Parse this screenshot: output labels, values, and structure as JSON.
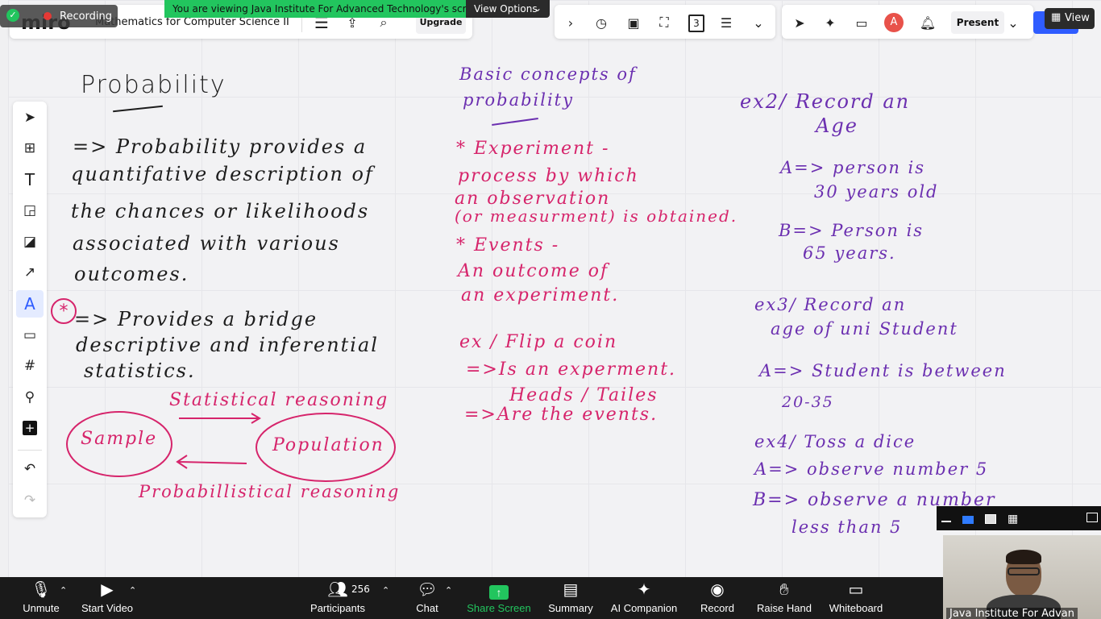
{
  "recording": {
    "label": "Recording"
  },
  "app": {
    "logo": "miro"
  },
  "share_banner": {
    "text": "You are viewing Java Institute For Advanced Technology's screen",
    "view_options": "View Options"
  },
  "board_title": "Mathematics for Computer Science II",
  "upgrade": "Upgrade",
  "toolbar_right": {
    "page_number": "3",
    "avatar_initial": "A",
    "present": "Present",
    "view": "View"
  },
  "notes": {
    "probability_title": "Probability",
    "def_lines": [
      "=> Probability provides a",
      "quantifative description of",
      "the chances or likelihoods",
      "associated with various",
      "outcomes."
    ],
    "bridge_lines": [
      "=> Provides a bridge",
      "descriptive and inferential",
      "statistics."
    ],
    "star_mark": "*",
    "statistical_reasoning": "Statistical reasoning",
    "sample": "Sample",
    "population": "Population",
    "probabilistic_reasoning": "Probabillistical reasoning",
    "basic_concepts_lines": [
      "Basic concepts of",
      "probability"
    ],
    "experiment_lines": [
      "* Experiment -",
      "process by which",
      "an observation",
      "(or measurment) is obtained."
    ],
    "events_lines": [
      "* Events -",
      "An outcome of",
      "an experiment."
    ],
    "ex1_lines": [
      "ex / Flip a coin",
      "=>Is an experment.",
      "Heads / Tailes",
      "=>Are the events."
    ],
    "ex2_lines": [
      "ex2/ Record an",
      "Age"
    ],
    "ex2_a_lines": [
      "A=> person is",
      "30 years old"
    ],
    "ex2_b_lines": [
      "B=> Person is",
      "65 years."
    ],
    "ex3_lines": [
      "ex3/ Record an",
      "age of uni Student"
    ],
    "ex3_a_lines": [
      "A=> Student is between",
      "20-35"
    ],
    "ex4_lines": [
      "ex4/ Toss a dice",
      "A=> observe number 5",
      "B=> observe a number",
      "less than 5"
    ]
  },
  "zoom_bar": {
    "unmute": "Unmute",
    "start_video": "Start Video",
    "participants": "Participants",
    "participant_count": "256",
    "chat": "Chat",
    "share_screen": "Share Screen",
    "summary": "Summary",
    "ai_companion": "AI Companion",
    "record": "Record",
    "raise_hand": "Raise Hand",
    "whiteboard": "Whiteboard"
  },
  "video_tile": {
    "name": "Java Institute For Advan"
  },
  "colors": {
    "ink_black": "#1d1d1d",
    "ink_pink": "#d6246b",
    "ink_purple": "#6b2fb0",
    "zoom_bar": "#1a1a1a",
    "share_green": "#22c55e",
    "miro_blue": "#2f5cff"
  }
}
